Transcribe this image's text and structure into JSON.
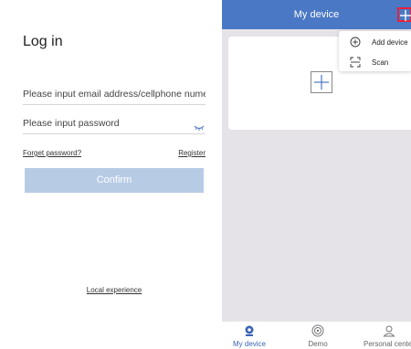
{
  "login": {
    "title": "Log in",
    "email_placeholder": "Please input email address/cellphone numer",
    "password_placeholder": "Please input password",
    "forget_password": "Forget password?",
    "register": "Register",
    "confirm": "Confirm",
    "local_experience": "Local experience"
  },
  "device": {
    "header_title": "My device",
    "menu": [
      {
        "label": "Add device",
        "icon": "add-circle-icon"
      },
      {
        "label": "Scan",
        "icon": "scan-icon"
      }
    ],
    "tabs": [
      {
        "label": "My device",
        "icon": "camera-icon",
        "active": true
      },
      {
        "label": "Demo",
        "icon": "demo-icon",
        "active": false
      },
      {
        "label": "Personal center",
        "icon": "person-icon",
        "active": false
      }
    ]
  },
  "colors": {
    "header_blue": "#4a78c5",
    "confirm_disabled": "#b7cbe5",
    "highlight_red": "#e8213a",
    "panel_bg": "#e6e3e8",
    "active_tab": "#3b64b4"
  }
}
